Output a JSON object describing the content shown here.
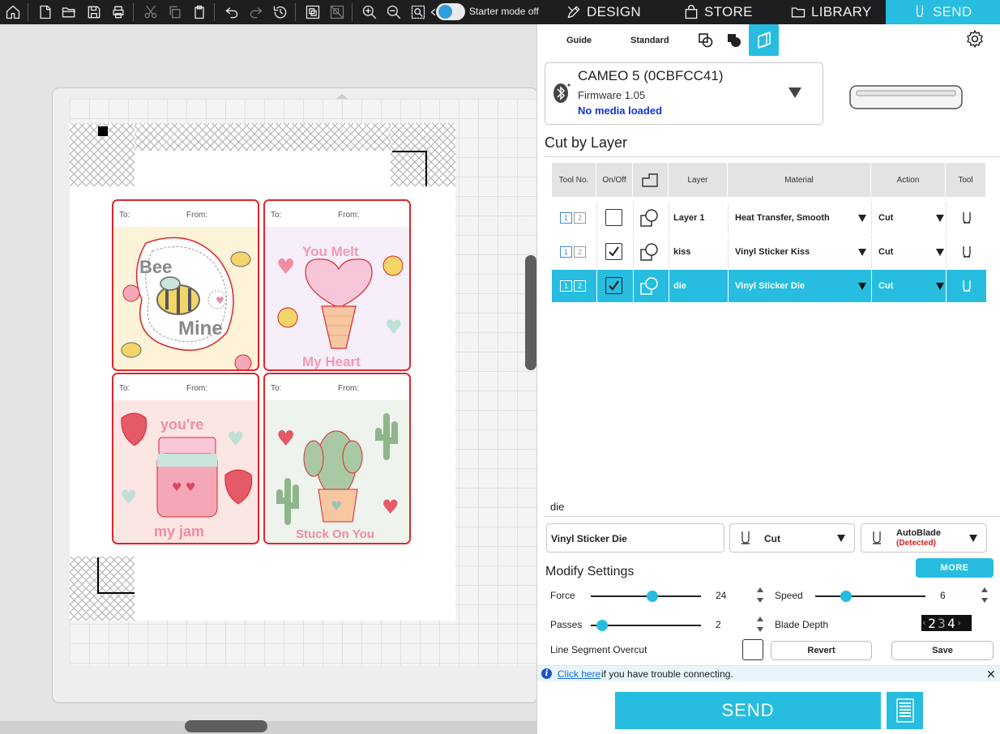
{
  "toolbar": {
    "starter_mode_label": "Starter mode off",
    "tabs": {
      "design": "DESIGN",
      "store": "STORE",
      "library": "LIBRARY",
      "send": "SEND"
    }
  },
  "canvas": {
    "cards": [
      {
        "to": "To:",
        "from": "From:",
        "top_text": "Bee",
        "bottom_text": "Mine",
        "bg": "#fdf3d9"
      },
      {
        "to": "To:",
        "from": "From:",
        "top_text": "You Melt",
        "bottom_text": "My Heart",
        "bg": "#f6eef8"
      },
      {
        "to": "To:",
        "from": "From:",
        "top_text": "you're",
        "bottom_text": "my jam",
        "bg": "#fce6e4"
      },
      {
        "to": "To:",
        "from": "From:",
        "top_text": "",
        "bottom_text": "Stuck On You",
        "bg": "#eef3ee"
      }
    ]
  },
  "panel": {
    "modes": {
      "guide": "Guide",
      "standard": "Standard"
    },
    "device": {
      "name": "CAMEO 5 (0CBFCC41)",
      "firmware": "Firmware 1.05",
      "media_status": "No media loaded"
    },
    "section_title": "Cut by Layer",
    "table": {
      "headers": {
        "tool_no": "Tool No.",
        "onoff": "On/Off",
        "layer": "Layer",
        "material": "Material",
        "action": "Action",
        "tool": "Tool"
      },
      "rows": [
        {
          "t1": "1",
          "t2": "2",
          "checked": false,
          "layer": "Layer 1",
          "material": "Heat Transfer, Smooth",
          "action": "Cut",
          "selected": false
        },
        {
          "t1": "1",
          "t2": "2",
          "checked": true,
          "layer": "kiss",
          "material": "Vinyl Sticker Kiss",
          "action": "Cut",
          "selected": false
        },
        {
          "t1": "1",
          "t2": "2",
          "checked": true,
          "layer": "die",
          "material": "Vinyl Sticker Die",
          "action": "Cut",
          "selected": true
        }
      ]
    },
    "selected_layer": {
      "name": "die",
      "material": "Vinyl Sticker Die",
      "action": "Cut",
      "blade": "AutoBlade",
      "blade_status": "(Detected)"
    },
    "settings": {
      "title": "Modify Settings",
      "more_label": "MORE",
      "force_label": "Force",
      "force_value": "24",
      "force_fraction": 0.56,
      "speed_label": "Speed",
      "speed_value": "6",
      "speed_fraction": 0.28,
      "passes_label": "Passes",
      "passes_value": "2",
      "passes_fraction": 0.1,
      "blade_depth_label": "Blade Depth",
      "blade_depth_digits": [
        "2",
        "3",
        "4"
      ],
      "overcut_label": "Line Segment Overcut",
      "revert_label": "Revert",
      "save_label": "Save"
    },
    "trouble": {
      "link": "Click here",
      "rest": "if you have trouble connecting."
    },
    "send_label": "SEND"
  },
  "colors": {
    "accent": "#27bde0",
    "cut_line": "#e0252b",
    "link": "#1a6ad6",
    "media_status": "#1334d6"
  }
}
